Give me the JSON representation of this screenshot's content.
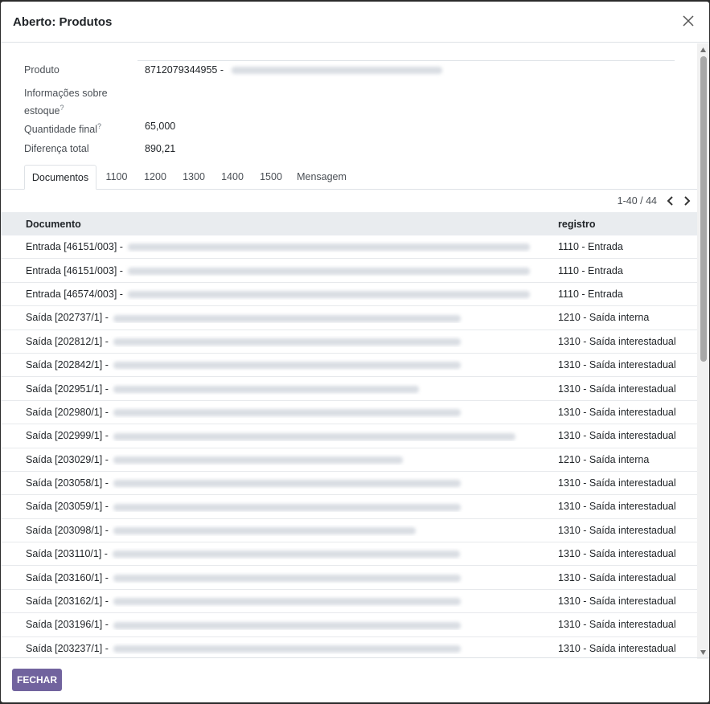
{
  "modal": {
    "title": "Aberto: Produtos"
  },
  "fields": {
    "produto_label": "Produto",
    "produto_value": "8712079344955 -",
    "info_label_line1": "Informações sobre",
    "info_label_line2": "estoque",
    "help_mark": "?",
    "quantidade_label": "Quantidade final",
    "quantidade_value": "65,000",
    "diferenca_label": "Diferença total",
    "diferenca_value": "890,21"
  },
  "tabs": [
    "Documentos",
    "1100",
    "1200",
    "1300",
    "1400",
    "1500",
    "Mensagem"
  ],
  "pager": {
    "text": "1-40 / 44"
  },
  "table": {
    "headers": {
      "documento": "Documento",
      "registro": "registro"
    },
    "rows": [
      {
        "doc": "Entrada [46151/003] -",
        "reg": "1110 - Entrada"
      },
      {
        "doc": "Entrada [46151/003] -",
        "reg": "1110 - Entrada"
      },
      {
        "doc": "Entrada [46574/003] -",
        "reg": "1110 - Entrada"
      },
      {
        "doc": "Saída [202737/1] -",
        "reg": "1210 - Saída interna"
      },
      {
        "doc": "Saída [202812/1] -",
        "reg": "1310 - Saída interestadual"
      },
      {
        "doc": "Saída [202842/1] -",
        "reg": "1310 - Saída interestadual"
      },
      {
        "doc": "Saída [202951/1] -",
        "reg": "1310 - Saída interestadual"
      },
      {
        "doc": "Saída [202980/1] -",
        "reg": "1310 - Saída interestadual"
      },
      {
        "doc": "Saída [202999/1] -",
        "reg": "1310 - Saída interestadual"
      },
      {
        "doc": "Saída [203029/1] -",
        "reg": "1210 - Saída interna"
      },
      {
        "doc": "Saída [203058/1] -",
        "reg": "1310 - Saída interestadual"
      },
      {
        "doc": "Saída [203059/1] -",
        "reg": "1310 - Saída interestadual"
      },
      {
        "doc": "Saída [203098/1] -",
        "reg": "1310 - Saída interestadual"
      },
      {
        "doc": "Saída [203110/1] -",
        "reg": "1310 - Saída interestadual"
      },
      {
        "doc": "Saída [203160/1] -",
        "reg": "1310 - Saída interestadual"
      },
      {
        "doc": "Saída [203162/1] -",
        "reg": "1310 - Saída interestadual"
      },
      {
        "doc": "Saída [203196/1] -",
        "reg": "1310 - Saída interestadual"
      },
      {
        "doc": "Saída [203237/1] -",
        "reg": "1310 - Saída interestadual"
      }
    ]
  },
  "footer": {
    "close_label": "FECHAR"
  },
  "colors": {
    "primary": "#71639e",
    "header_bg": "#e9ecef"
  },
  "icons": {
    "close": "close-icon",
    "prev": "chevron-left-icon",
    "next": "chevron-right-icon"
  }
}
